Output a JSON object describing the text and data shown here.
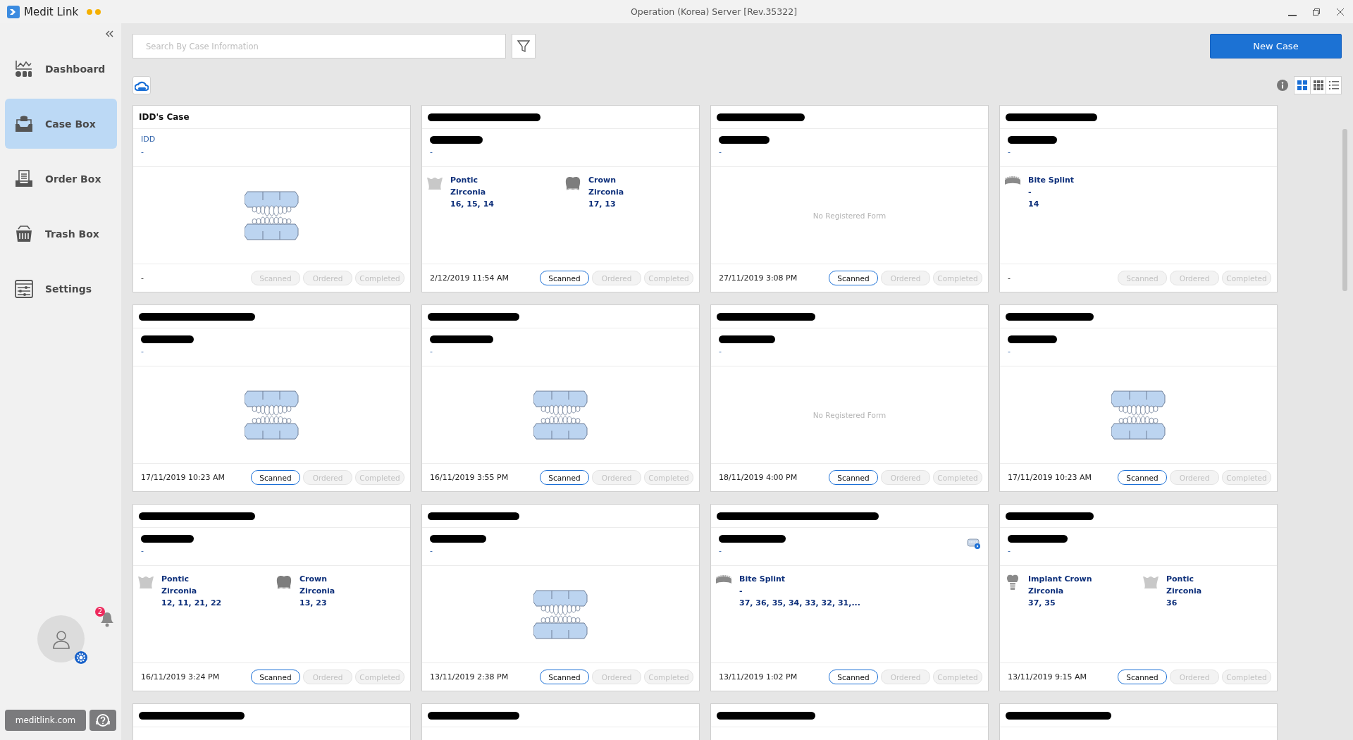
{
  "window": {
    "app_name": "Medit Link",
    "title": "Operation (Korea) Server [Rev.35322]"
  },
  "sidebar": {
    "items": [
      {
        "label": "Dashboard",
        "kind": "dashboard",
        "selected": false
      },
      {
        "label": "Case Box",
        "kind": "casebox",
        "selected": true
      },
      {
        "label": "Order Box",
        "kind": "orderbox",
        "selected": false
      },
      {
        "label": "Trash Box",
        "kind": "trashbox",
        "selected": false
      },
      {
        "label": "Settings",
        "kind": "settings",
        "selected": false
      }
    ],
    "notification_count": "2",
    "link": "meditlink.com"
  },
  "toolbar": {
    "search": {
      "placeholder": "Search By Case Information"
    },
    "new_case": "New Case",
    "view_modes": [
      {
        "kind": "large",
        "selected": true
      },
      {
        "kind": "small",
        "selected": false
      },
      {
        "kind": "list",
        "selected": false
      }
    ]
  },
  "cards": [
    {
      "title": "IDD's Case",
      "patient": "IDD",
      "detail": "-",
      "kind": "model",
      "date": "-",
      "statuses": [
        {
          "label": "Scanned",
          "active": false
        },
        {
          "label": "Ordered",
          "active": false
        },
        {
          "label": "Completed",
          "active": false
        }
      ]
    },
    {
      "title_redacted": true,
      "patient_redacted": true,
      "detail": "-",
      "kind": "items",
      "items": [
        {
          "kind": "pontic",
          "lines": [
            "Pontic",
            "Zirconia",
            "16, 15, 14"
          ]
        },
        {
          "kind": "crown",
          "lines": [
            "Crown",
            "Zirconia",
            "17, 13"
          ]
        }
      ],
      "date": "2/12/2019 11:54 AM",
      "statuses": [
        {
          "label": "Scanned",
          "active": true
        },
        {
          "label": "Ordered",
          "active": false
        },
        {
          "label": "Completed",
          "active": false
        }
      ]
    },
    {
      "title_redacted": true,
      "patient_redacted": true,
      "detail": "-",
      "kind": "empty",
      "empty_text": "No Registered Form",
      "date": "27/11/2019 3:08 PM",
      "statuses": [
        {
          "label": "Scanned",
          "active": true
        },
        {
          "label": "Ordered",
          "active": false
        },
        {
          "label": "Completed",
          "active": false
        }
      ]
    },
    {
      "title_redacted": true,
      "patient_redacted": true,
      "detail": "-",
      "kind": "items",
      "items": [
        {
          "kind": "splint",
          "lines": [
            "Bite Splint",
            "-",
            "14"
          ]
        }
      ],
      "date": "-",
      "statuses": [
        {
          "label": "Scanned",
          "active": false
        },
        {
          "label": "Ordered",
          "active": false
        },
        {
          "label": "Completed",
          "active": false
        }
      ]
    },
    {
      "title_redacted": true,
      "patient_redacted": true,
      "detail": "-",
      "kind": "model",
      "date": "17/11/2019 10:23 AM",
      "statuses": [
        {
          "label": "Scanned",
          "active": true
        },
        {
          "label": "Ordered",
          "active": false
        },
        {
          "label": "Completed",
          "active": false
        }
      ]
    },
    {
      "title_redacted": true,
      "patient_redacted": true,
      "detail": "-",
      "kind": "model",
      "date": "16/11/2019 3:55 PM",
      "statuses": [
        {
          "label": "Scanned",
          "active": true
        },
        {
          "label": "Ordered",
          "active": false
        },
        {
          "label": "Completed",
          "active": false
        }
      ]
    },
    {
      "title_redacted": true,
      "patient_redacted": true,
      "detail": "-",
      "kind": "empty",
      "empty_text": "No Registered Form",
      "date": "18/11/2019 4:00 PM",
      "statuses": [
        {
          "label": "Scanned",
          "active": true
        },
        {
          "label": "Ordered",
          "active": false
        },
        {
          "label": "Completed",
          "active": false
        }
      ]
    },
    {
      "title_redacted": true,
      "patient_redacted": true,
      "detail": "-",
      "kind": "model",
      "date": "17/11/2019 10:23 AM",
      "statuses": [
        {
          "label": "Scanned",
          "active": true
        },
        {
          "label": "Ordered",
          "active": false
        },
        {
          "label": "Completed",
          "active": false
        }
      ]
    },
    {
      "title_redacted": true,
      "patient_redacted": true,
      "detail": "-",
      "kind": "items",
      "items": [
        {
          "kind": "pontic",
          "lines": [
            "Pontic",
            "Zirconia",
            "12, 11, 21, 22"
          ]
        },
        {
          "kind": "crown",
          "lines": [
            "Crown",
            "Zirconia",
            "13, 23"
          ]
        }
      ],
      "date": "16/11/2019 3:24 PM",
      "statuses": [
        {
          "label": "Scanned",
          "active": true
        },
        {
          "label": "Ordered",
          "active": false
        },
        {
          "label": "Completed",
          "active": false
        }
      ]
    },
    {
      "title_redacted": true,
      "patient_redacted": true,
      "detail": "-",
      "kind": "model",
      "date": "13/11/2019 2:38 PM",
      "statuses": [
        {
          "label": "Scanned",
          "active": true
        },
        {
          "label": "Ordered",
          "active": false
        },
        {
          "label": "Completed",
          "active": false
        }
      ]
    },
    {
      "title_redacted": true,
      "patient_redacted": true,
      "detail": "-",
      "scan_badge": true,
      "kind": "items",
      "items": [
        {
          "kind": "splint",
          "lines": [
            "Bite Splint",
            "-",
            "37, 36, 35, 34, 33, 32, 31,..."
          ]
        }
      ],
      "date": "13/11/2019 1:02 PM",
      "statuses": [
        {
          "label": "Scanned",
          "active": true
        },
        {
          "label": "Ordered",
          "active": false
        },
        {
          "label": "Completed",
          "active": false
        }
      ]
    },
    {
      "title_redacted": true,
      "patient_redacted": true,
      "detail": "-",
      "kind": "items",
      "items": [
        {
          "kind": "implant",
          "lines": [
            "Implant Crown",
            "Zirconia",
            "37, 35"
          ]
        },
        {
          "kind": "pontic",
          "lines": [
            "Pontic",
            "Zirconia",
            "36"
          ]
        }
      ],
      "date": "13/11/2019 9:15 AM",
      "statuses": [
        {
          "label": "Scanned",
          "active": true
        },
        {
          "label": "Ordered",
          "active": false
        },
        {
          "label": "Completed",
          "active": false
        }
      ]
    },
    {
      "title_redacted": true
    },
    {
      "title_redacted": true
    },
    {
      "title_redacted": true
    },
    {
      "title_redacted": true
    }
  ]
}
